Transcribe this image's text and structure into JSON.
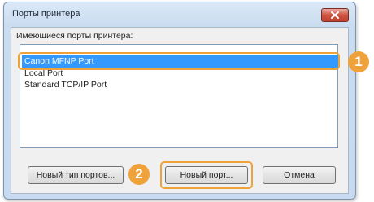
{
  "window": {
    "title": "Порты принтера"
  },
  "ports": {
    "label": "Имеющиеся порты принтера:",
    "items": [
      {
        "label": "Canon MFNP Port",
        "selected": true
      },
      {
        "label": "Local Port",
        "selected": false
      },
      {
        "label": "Standard TCP/IP Port",
        "selected": false
      }
    ]
  },
  "buttons": {
    "new_port_type": "Новый тип портов...",
    "new_port": "Новый порт...",
    "cancel": "Отмена"
  },
  "callouts": {
    "step1": "1",
    "step2": "2"
  },
  "colors": {
    "highlight": "#f0a23a",
    "selection": "#3399ff"
  },
  "icons": {
    "close": "close-icon"
  }
}
